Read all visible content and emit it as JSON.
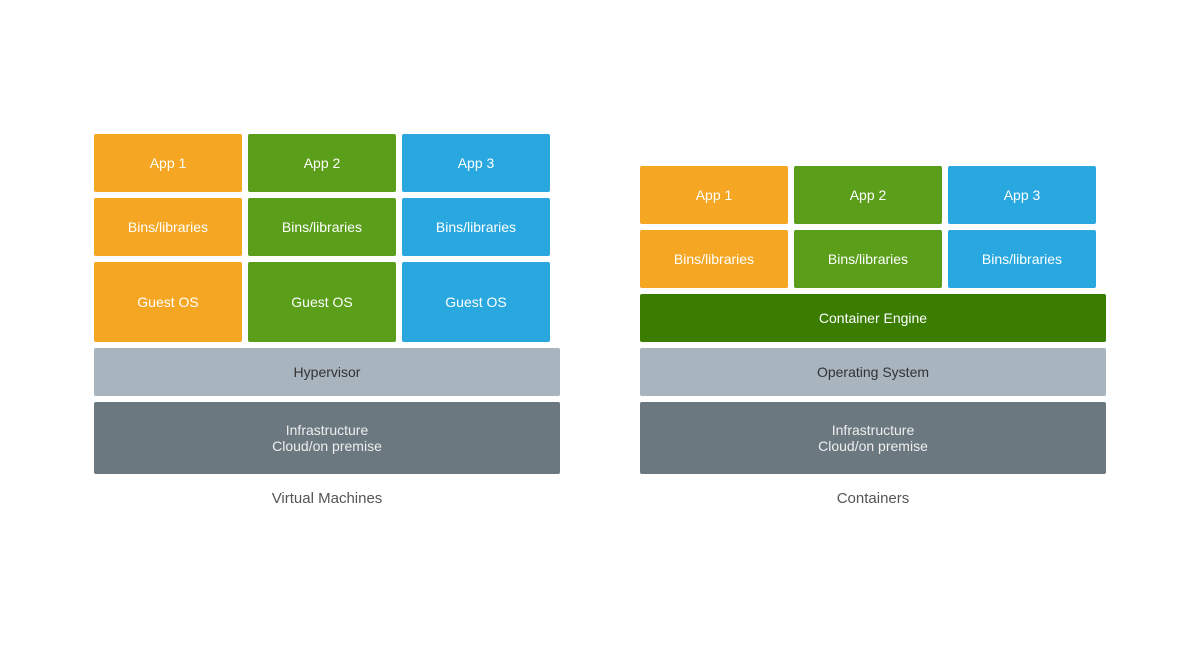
{
  "vm": {
    "label": "Virtual Machines",
    "row1": [
      "App 1",
      "App 2",
      "App 3"
    ],
    "row2": [
      "Bins/libraries",
      "Bins/libraries",
      "Bins/libraries"
    ],
    "row3": [
      "Guest OS",
      "Guest OS",
      "Guest OS"
    ],
    "hypervisor": "Hypervisor",
    "infra": "Infrastructure\nCloud/on premise"
  },
  "ct": {
    "label": "Containers",
    "row1": [
      "App 1",
      "App 2",
      "App 3"
    ],
    "row2": [
      "Bins/libraries",
      "Bins/libraries",
      "Bins/libraries"
    ],
    "engine": "Container Engine",
    "os": "Operating System",
    "infra": "Infrastructure\nCloud/on premise"
  }
}
